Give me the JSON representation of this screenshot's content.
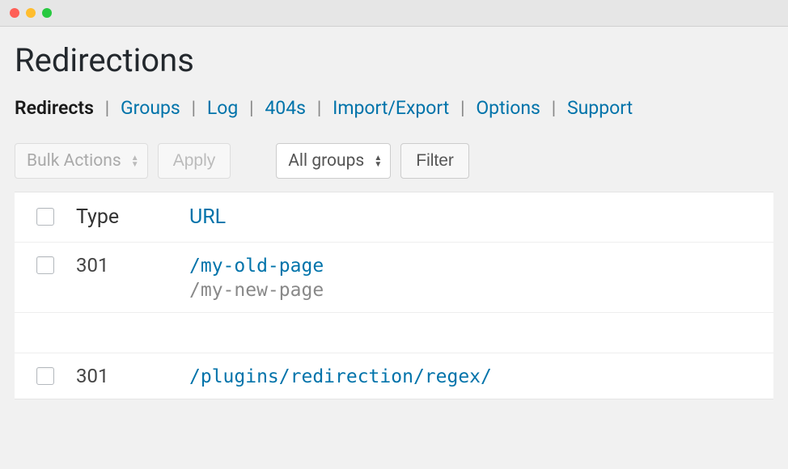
{
  "page": {
    "title": "Redirections"
  },
  "tabs": {
    "redirects": "Redirects",
    "groups": "Groups",
    "log": "Log",
    "404s": "404s",
    "import_export": "Import/Export",
    "options": "Options",
    "support": "Support"
  },
  "toolbar": {
    "bulk_actions": "Bulk Actions",
    "apply": "Apply",
    "group_filter": "All groups",
    "filter": "Filter"
  },
  "table": {
    "headers": {
      "type": "Type",
      "url": "URL"
    },
    "rows": [
      {
        "type": "301",
        "source": "/my-old-page",
        "destination": "/my-new-page"
      },
      {
        "type": "301",
        "source": "/plugins/redirection/regex/",
        "destination": ""
      }
    ]
  }
}
